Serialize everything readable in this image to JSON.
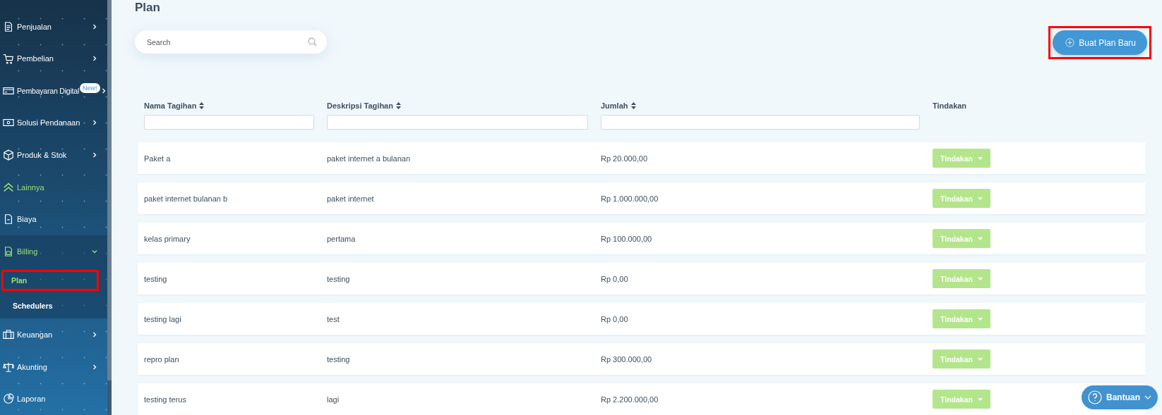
{
  "sidebar": {
    "items": [
      {
        "label": "Penjualan",
        "kind": "group",
        "active": false,
        "expanded": false
      },
      {
        "label": "Pembelian",
        "kind": "group",
        "active": false,
        "expanded": false
      },
      {
        "label": "Pembayaran Digital",
        "kind": "group",
        "active": false,
        "expanded": false,
        "badge": "New!"
      },
      {
        "label": "Solusi Pendanaan",
        "kind": "group",
        "active": false,
        "expanded": false
      },
      {
        "label": "Produk & Stok",
        "kind": "group",
        "active": false,
        "expanded": false
      },
      {
        "label": "Lainnya",
        "kind": "link",
        "active": true
      },
      {
        "label": "Biaya",
        "kind": "link",
        "active": false
      },
      {
        "label": "Billing",
        "kind": "group",
        "active": true,
        "expanded": true,
        "children": [
          {
            "label": "Plan",
            "selected": true,
            "highlighted": true
          },
          {
            "label": "Schedulers",
            "selected": false,
            "highlighted": false
          }
        ]
      },
      {
        "label": "Keuangan",
        "kind": "group",
        "active": false,
        "expanded": false
      },
      {
        "label": "Akunting",
        "kind": "group",
        "active": false,
        "expanded": false
      },
      {
        "label": "Laporan",
        "kind": "link",
        "active": false
      }
    ]
  },
  "page_title": "Plan",
  "search": {
    "placeholder": "Search"
  },
  "create_button": {
    "label": "Buat Plan Baru",
    "highlighted": true
  },
  "table": {
    "columns": [
      {
        "label": "Nama Tagihan",
        "kind": "sortable"
      },
      {
        "label": "Deskripsi Tagihan",
        "kind": "sortable"
      },
      {
        "label": "Jumlah",
        "kind": "sortable"
      },
      {
        "label": "Tindakan",
        "kind": "plain"
      }
    ],
    "rows": [
      {
        "name": "Paket a",
        "description": "paket internet a bulanan",
        "amount": "Rp 20.000,00",
        "action": "Tindakan"
      },
      {
        "name": "paket internet bulanan b",
        "description": "paket internet",
        "amount": "Rp 1.000.000,00",
        "action": "Tindakan"
      },
      {
        "name": "kelas primary",
        "description": "pertama",
        "amount": "Rp 100.000,00",
        "action": "Tindakan"
      },
      {
        "name": "testing",
        "description": "testing",
        "amount": "Rp 0,00",
        "action": "Tindakan"
      },
      {
        "name": "testing lagi",
        "description": "test",
        "amount": "Rp 0,00",
        "action": "Tindakan"
      },
      {
        "name": "repro plan",
        "description": "testing",
        "amount": "Rp 300.000,00",
        "action": "Tindakan"
      },
      {
        "name": "testing terus",
        "description": "lagi",
        "amount": "Rp 2.200.000,00",
        "action": "Tindakan"
      }
    ]
  },
  "help_button": {
    "label": "Bantuan"
  }
}
